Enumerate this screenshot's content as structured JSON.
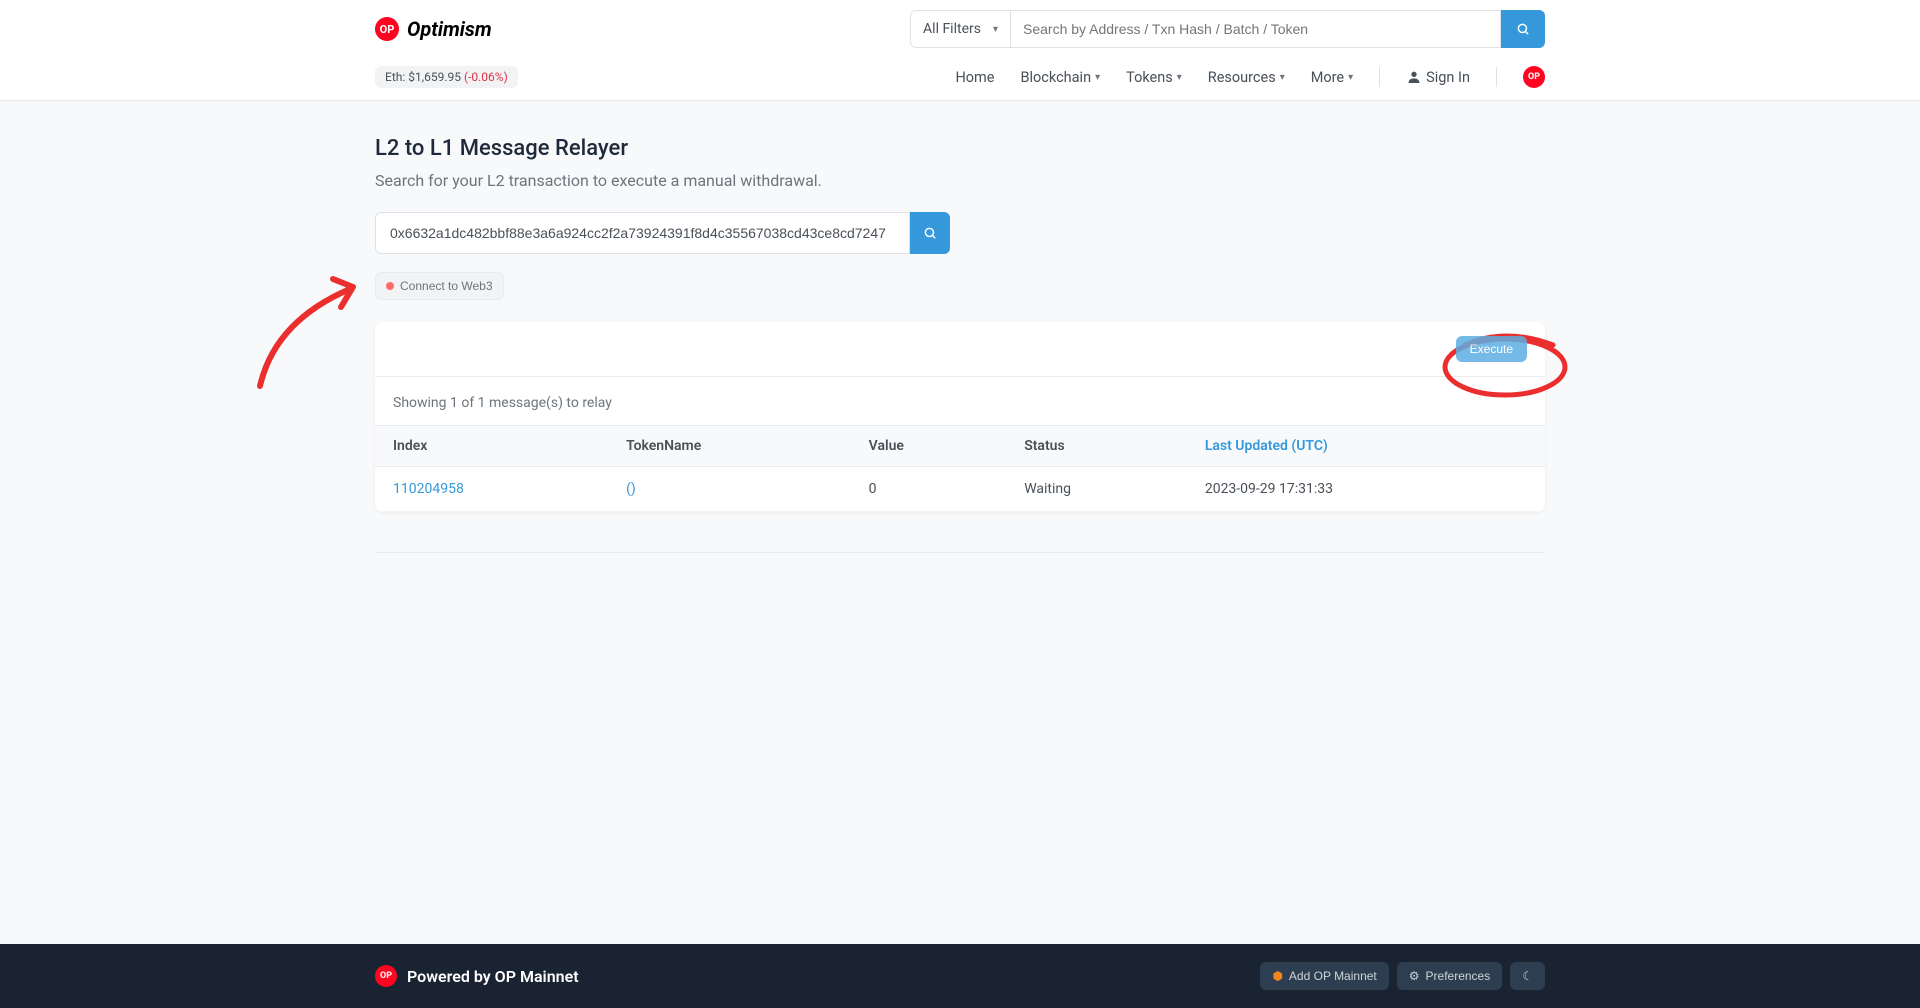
{
  "header": {
    "brand": "Optimism",
    "logo_badge": "OP",
    "filter_label": "All Filters",
    "search_placeholder": "Search by Address / Txn Hash / Batch / Token",
    "eth_label": "Eth: ",
    "eth_price": "$1,659.95",
    "eth_change": "(-0.06%)",
    "nav": {
      "home": "Home",
      "blockchain": "Blockchain",
      "tokens": "Tokens",
      "resources": "Resources",
      "more": "More",
      "signin": "Sign In"
    }
  },
  "page": {
    "title": "L2 to L1 Message Relayer",
    "subtitle": "Search for your L2 transaction to execute a manual withdrawal.",
    "tx_value": "0x6632a1dc482bbf88e3a6a924cc2f2a73924391f8d4c35567038cd43ce8cd7247",
    "connect_label": "Connect to Web3",
    "execute_label": "Execute",
    "showing_text": "Showing 1 of 1 message(s) to relay"
  },
  "table": {
    "headers": {
      "index": "Index",
      "token": "TokenName",
      "value": "Value",
      "status": "Status",
      "updated": "Last Updated (UTC)"
    },
    "rows": [
      {
        "index": "110204958",
        "token": "()",
        "value": "0",
        "status": "Waiting",
        "updated": "2023-09-29 17:31:33"
      }
    ]
  },
  "footer": {
    "powered": "Powered by OP Mainnet",
    "add_mainnet": "Add OP Mainnet",
    "preferences": "Preferences"
  }
}
